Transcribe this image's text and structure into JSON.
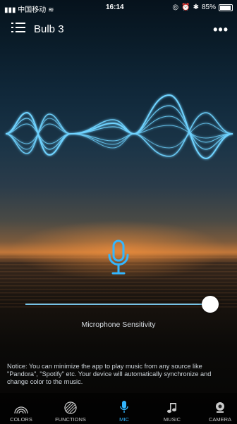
{
  "status_bar": {
    "carrier": "中国移动",
    "time": "16:14",
    "battery": "85%"
  },
  "nav": {
    "title": "Bulb 3",
    "more": "•••"
  },
  "slider": {
    "label": "Microphone Sensitivity",
    "value_fraction": 1.0
  },
  "notice": "Notice: You can minimize the app to play music from any source like \"Pandora\", \"Spotify\" etc. Your device will automatically synchronize and change color to the music.",
  "tabs": [
    {
      "label": "COLORS",
      "icon": "colors-icon",
      "active": false
    },
    {
      "label": "FUNCTIONS",
      "icon": "functions-icon",
      "active": false
    },
    {
      "label": "MIC",
      "icon": "mic-icon",
      "active": true
    },
    {
      "label": "MUSIC",
      "icon": "music-icon",
      "active": false
    },
    {
      "label": "CAMERA",
      "icon": "camera-icon",
      "active": false
    }
  ],
  "colors": {
    "accent": "#33b6ff",
    "wave": "#6fd3ff"
  }
}
